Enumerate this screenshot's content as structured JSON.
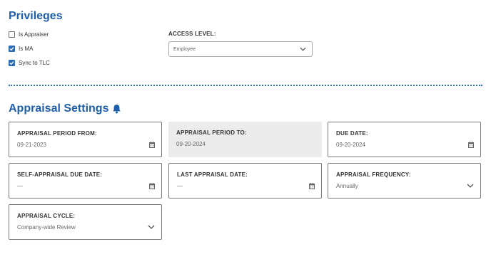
{
  "privileges": {
    "title": "Privileges",
    "checkboxes": [
      {
        "label": "Is Appraiser",
        "checked": false
      },
      {
        "label": "Is MA",
        "checked": true
      },
      {
        "label": "Sync to TLC",
        "checked": true
      }
    ],
    "access_level": {
      "label": "ACCESS LEVEL:",
      "value": "Employee"
    }
  },
  "appraisal": {
    "title": "Appraisal Settings",
    "title_icon": "bell-icon",
    "fields": {
      "period_from": {
        "label": "APPRAISAL PERIOD FROM:",
        "value": "09-21-2023",
        "icon": "calendar-icon"
      },
      "period_to": {
        "label": "APPRAISAL PERIOD TO:",
        "value": "09-20-2024"
      },
      "due_date": {
        "label": "DUE DATE:",
        "value": "09-20-2024",
        "icon": "calendar-icon"
      },
      "self_due_date": {
        "label": "SELF-APPRAISAL DUE DATE:",
        "value": "—",
        "icon": "calendar-icon"
      },
      "last_date": {
        "label": "LAST APPRAISAL DATE:",
        "value": "—",
        "icon": "calendar-icon"
      },
      "frequency": {
        "label": "APPRAISAL FREQUENCY:",
        "value": "Annually",
        "icon": "chevron-down-icon"
      },
      "cycle": {
        "label": "APPRAISAL CYCLE:",
        "value": "Company-wide Review",
        "icon": "chevron-down-icon"
      }
    }
  },
  "colors": {
    "accent": "#1f5fa8",
    "checkbox": "#2e6bb5",
    "disabled_field": "#ececec"
  }
}
